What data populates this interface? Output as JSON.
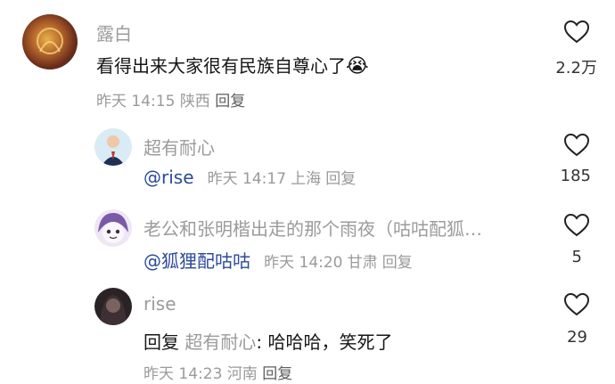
{
  "comments": [
    {
      "username": "露白",
      "text": "看得出来大家很有民族自尊心了",
      "emoji": "😭",
      "time": "昨天 14:15",
      "location": "陕西",
      "reply_label": "回复",
      "likes": "2.2万"
    },
    {
      "username": "超有耐心",
      "mention": "@rise",
      "time": "昨天 14:17",
      "location": "上海",
      "reply_label": "回复",
      "likes": "185"
    },
    {
      "username": "老公和张明楷出走的那个雨夜（咕咕配狐…",
      "mention": "@狐狸配咕咕",
      "time": "昨天 14:20",
      "location": "甘肃",
      "reply_label": "回复",
      "likes": "5"
    },
    {
      "username": "rise",
      "reply_prefix": "回复",
      "reply_target": "超有耐心",
      "text": ": 哈哈哈，笑死了",
      "time": "昨天 14:23",
      "location": "河南",
      "reply_label": "回复",
      "likes": "29"
    }
  ],
  "icons": {
    "like": "heart-outline-icon"
  }
}
